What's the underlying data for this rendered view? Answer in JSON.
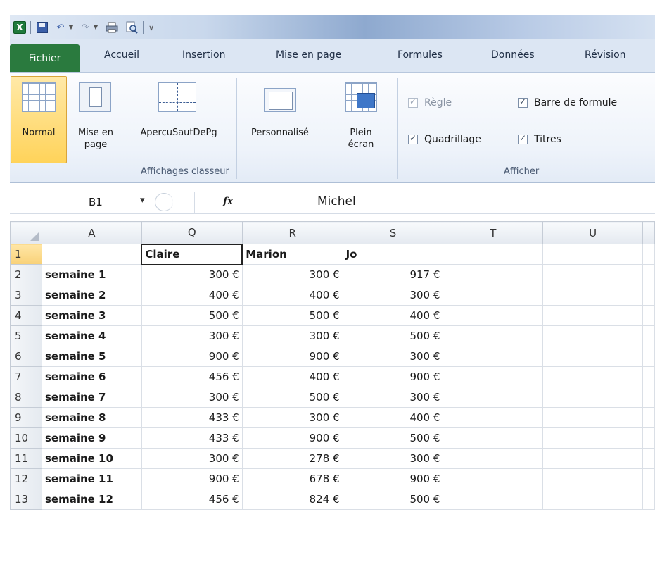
{
  "window": {
    "app_icon": "excel-icon",
    "quick_access": [
      "save-icon",
      "undo-icon",
      "redo-icon",
      "print-icon",
      "print-preview-icon",
      "customize-icon"
    ]
  },
  "tabs": [
    {
      "label": "Fichier"
    },
    {
      "label": "Accueil"
    },
    {
      "label": "Insertion"
    },
    {
      "label": "Mise en page"
    },
    {
      "label": "Formules"
    },
    {
      "label": "Données"
    },
    {
      "label": "Révision"
    }
  ],
  "ribbon": {
    "views_group": {
      "label": "Affichages classeur",
      "buttons": {
        "normal": "Normal",
        "page_layout_1": "Mise en",
        "page_layout_2": "page",
        "page_break": "AperçuSautDePg",
        "custom": "Personnalisé",
        "fullscreen_1": "Plein",
        "fullscreen_2": "écran"
      }
    },
    "show_group": {
      "label": "Afficher",
      "checks": {
        "ruler": {
          "label": "Règle",
          "checked": true
        },
        "formula_bar": {
          "label": "Barre de formule",
          "checked": true
        },
        "gridlines": {
          "label": "Quadrillage",
          "checked": true
        },
        "headings": {
          "label": "Titres",
          "checked": true
        }
      }
    }
  },
  "formula_bar": {
    "name_box": "B1",
    "fx": "fx",
    "value": "Michel"
  },
  "sheet": {
    "columns": [
      "A",
      "Q",
      "R",
      "S",
      "T",
      "U"
    ],
    "header_row": [
      "",
      "Claire",
      "Marion",
      "Jo",
      "",
      ""
    ],
    "rows": [
      {
        "n": "2",
        "label": "semaine 1",
        "q": "300 €",
        "r": "300 €",
        "s": "917 €"
      },
      {
        "n": "3",
        "label": "semaine 2",
        "q": "400 €",
        "r": "400 €",
        "s": "300 €"
      },
      {
        "n": "4",
        "label": "semaine 3",
        "q": "500 €",
        "r": "500 €",
        "s": "400 €"
      },
      {
        "n": "5",
        "label": "semaine 4",
        "q": "300 €",
        "r": "300 €",
        "s": "500 €"
      },
      {
        "n": "6",
        "label": "semaine 5",
        "q": "900 €",
        "r": "900 €",
        "s": "300 €"
      },
      {
        "n": "7",
        "label": "semaine 6",
        "q": "456 €",
        "r": "400 €",
        "s": "900 €"
      },
      {
        "n": "8",
        "label": "semaine 7",
        "q": "300 €",
        "r": "500 €",
        "s": "300 €"
      },
      {
        "n": "9",
        "label": "semaine 8",
        "q": "433 €",
        "r": "300 €",
        "s": "400 €"
      },
      {
        "n": "10",
        "label": "semaine 9",
        "q": "433 €",
        "r": "900 €",
        "s": "500 €"
      },
      {
        "n": "11",
        "label": "semaine 10",
        "q": "300 €",
        "r": "278 €",
        "s": "300 €"
      },
      {
        "n": "12",
        "label": "semaine 11",
        "q": "900 €",
        "r": "678 €",
        "s": "900 €"
      },
      {
        "n": "13",
        "label": "semaine 12",
        "q": "456 €",
        "r": "824 €",
        "s": "500 €"
      }
    ]
  },
  "colors": {
    "file_tab": "#2a7a3e",
    "selected_header": "#f8d178",
    "ribbon_bg": "#eef3fa"
  }
}
